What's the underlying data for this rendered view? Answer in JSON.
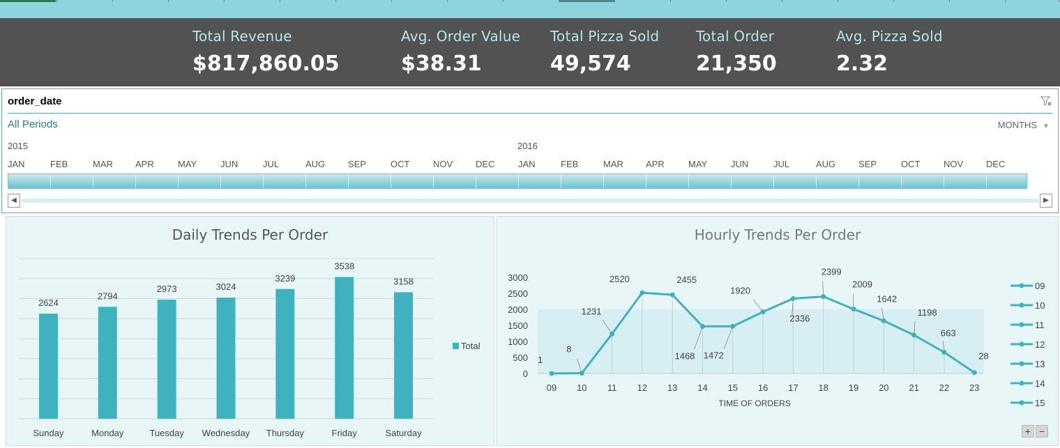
{
  "kpis": [
    {
      "label": "Total Revenue",
      "value": "$817,860.05"
    },
    {
      "label": "Avg. Order Value",
      "value": "$38.31"
    },
    {
      "label": "Total Pizza Sold",
      "value": "49,574"
    },
    {
      "label": "Total Order",
      "value": "21,350"
    },
    {
      "label": "Avg. Pizza Sold",
      "value": "2.32"
    }
  ],
  "slicer": {
    "title": "order_date",
    "periods": "All Periods",
    "level": "MONTHS",
    "years": [
      "2015",
      "2016"
    ],
    "months": [
      "JAN",
      "FEB",
      "MAR",
      "APR",
      "MAY",
      "JUN",
      "JUL",
      "AUG",
      "SEP",
      "OCT",
      "NOV",
      "DEC",
      "JAN",
      "FEB",
      "MAR",
      "APR",
      "MAY",
      "JUN",
      "JUL",
      "AUG",
      "SEP",
      "OCT",
      "NOV",
      "DEC"
    ]
  },
  "chart_data": [
    {
      "type": "bar",
      "title": "Daily Trends Per Order",
      "categories": [
        "Sunday",
        "Monday",
        "Tuesday",
        "Wednesday",
        "Thursday",
        "Friday",
        "Saturday"
      ],
      "series": [
        {
          "name": "Total",
          "values": [
            2624,
            2794,
            2973,
            3024,
            3239,
            3538,
            3158
          ]
        }
      ],
      "ylim": [
        0,
        4000
      ],
      "grid": true,
      "legend": "right",
      "color": "#3fb1bf"
    },
    {
      "type": "line",
      "title": "Hourly Trends Per Order",
      "xlabel": "TIME OF ORDERS",
      "x": [
        "09",
        "10",
        "11",
        "12",
        "13",
        "14",
        "15",
        "16",
        "17",
        "18",
        "19",
        "20",
        "21",
        "22",
        "23"
      ],
      "values": [
        1,
        8,
        1231,
        2520,
        2455,
        1468,
        1472,
        1920,
        2336,
        2399,
        2009,
        1642,
        1198,
        663,
        28
      ],
      "yticks": [
        0,
        500,
        1000,
        1500,
        2000,
        2500,
        3000
      ],
      "ylim": [
        0,
        3000
      ],
      "legend": "right",
      "legend_entries": [
        "09",
        "10",
        "11",
        "12",
        "13",
        "14",
        "15"
      ],
      "color": "#3fb1bf"
    }
  ]
}
